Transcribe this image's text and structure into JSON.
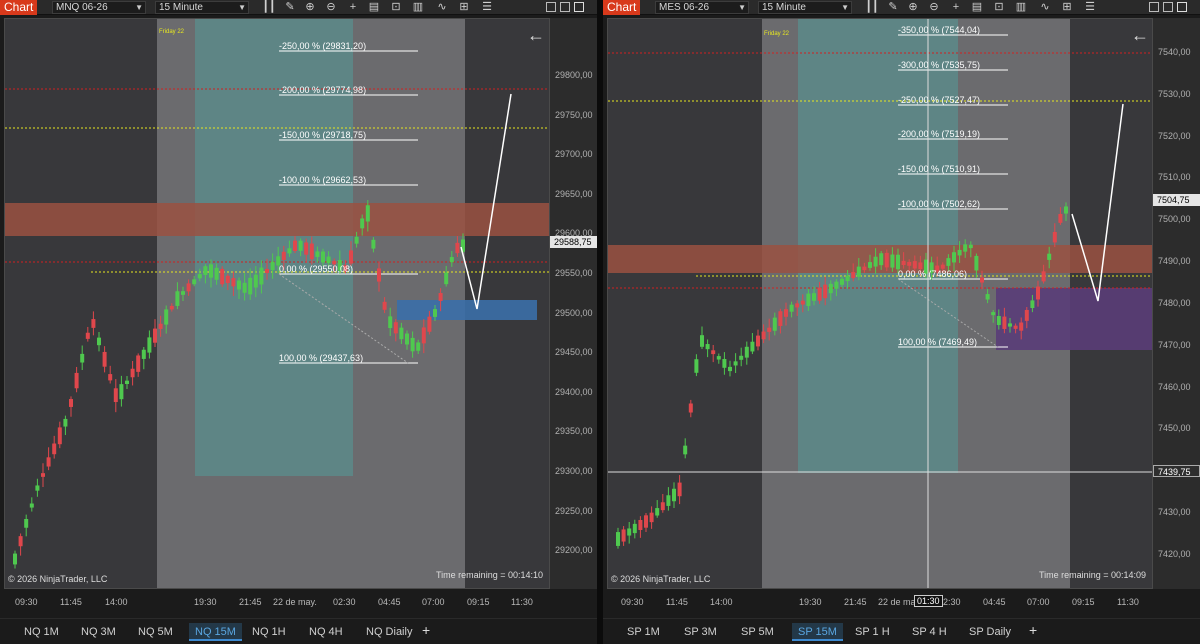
{
  "common": {
    "chart_label": "Chart",
    "timeframe": "15 Minute",
    "copyright": "© 2026 NinjaTrader, LLC",
    "flag": "F",
    "session_label": "Friday 22"
  },
  "left": {
    "instrument": "MNQ 06-26",
    "price_ticks": [
      "29800,00",
      "29750,00",
      "29700,00",
      "29650,00",
      "29600,00",
      "29550,00",
      "29500,00",
      "29450,00",
      "29400,00",
      "29350,00",
      "29300,00",
      "29250,00",
      "29200,00"
    ],
    "current_price": "29588,75",
    "time_remaining": "Time remaining = 00:14:10",
    "fib_levels": [
      "-250,00 % (29831,20)",
      "-200,00 % (29774,98)",
      "-150,00 % (29718,75)",
      "-100,00 % (29662,53)",
      "0,00 % (29550,08)",
      "100,00 % (29437,63)"
    ],
    "time_ticks": [
      "09:30",
      "11:45",
      "14:00",
      "19:30",
      "21:45",
      "22 de may.",
      "02:30",
      "04:45",
      "07:00",
      "09:15",
      "11:30"
    ],
    "tabs": [
      "NQ 1M",
      "NQ 3M",
      "NQ 5M",
      "NQ 15M",
      "NQ 1H",
      "NQ 4H",
      "NQ Diaily"
    ],
    "selected_tab": "NQ 15M",
    "colors": {
      "candle_up": "#4fc94f",
      "candle_down": "#e0474c",
      "supply_zone": "#9a5142",
      "demand_zone": "#3b6fa8",
      "red_line": "#d02020",
      "yellow_line": "#e6e620"
    }
  },
  "right": {
    "instrument": "MES 06-26",
    "price_ticks": [
      "7540,00",
      "7530,00",
      "7520,00",
      "7510,00",
      "7500,00",
      "7490,00",
      "7480,00",
      "7470,00",
      "7460,00",
      "7450,00",
      "7440,00",
      "7430,00",
      "7420,00"
    ],
    "current_price": "7504,75",
    "crosshair_price": "7439,75",
    "crosshair_time": "01:30",
    "time_remaining": "Time remaining = 00:14:09",
    "fib_levels": [
      "-350,00 % (7544,04)",
      "-300,00 % (7535,75)",
      "-250,00 % (7527,47)",
      "-200,00 % (7519,19)",
      "-150,00 % (7510,91)",
      "-100,00 % (7502,62)",
      "0,00 % (7486,06)",
      "100,00 % (7469,49)"
    ],
    "time_ticks": [
      "09:30",
      "11:45",
      "14:00",
      "19:30",
      "21:45",
      "22 de ma",
      "02:30",
      "04:45",
      "07:00",
      "09:15",
      "11:30"
    ],
    "tabs": [
      "SP 1M",
      "SP 3M",
      "SP 5M",
      "SP 15M",
      "SP 1 H",
      "SP 4 H",
      "SP Daily"
    ],
    "selected_tab": "SP 15M",
    "colors": {
      "candle_up": "#4fc94f",
      "candle_down": "#e0474c",
      "supply_zone": "#9a5142",
      "demand_zone": "#5a3d78",
      "red_line": "#d02020",
      "yellow_line": "#e6e620"
    }
  }
}
